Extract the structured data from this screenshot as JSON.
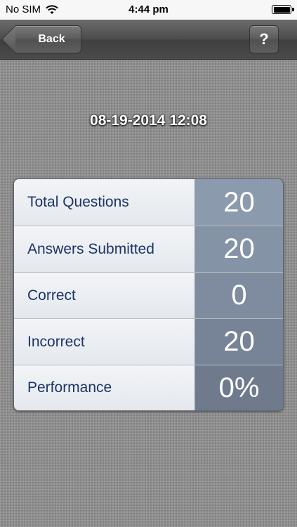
{
  "status_bar": {
    "carrier": "No SIM",
    "time": "4:44 pm"
  },
  "nav": {
    "back_label": "Back",
    "help_label": "?"
  },
  "session": {
    "datetime": "08-19-2014 12:08"
  },
  "stats": [
    {
      "label": "Total Questions",
      "value": "20"
    },
    {
      "label": "Answers Submitted",
      "value": "20"
    },
    {
      "label": "Correct",
      "value": "0"
    },
    {
      "label": "Incorrect",
      "value": "20"
    },
    {
      "label": "Performance",
      "value": "0%"
    }
  ],
  "icons": {
    "wifi": "wifi-icon",
    "battery": "battery-icon",
    "back_arrow": "back-arrow-icon"
  }
}
